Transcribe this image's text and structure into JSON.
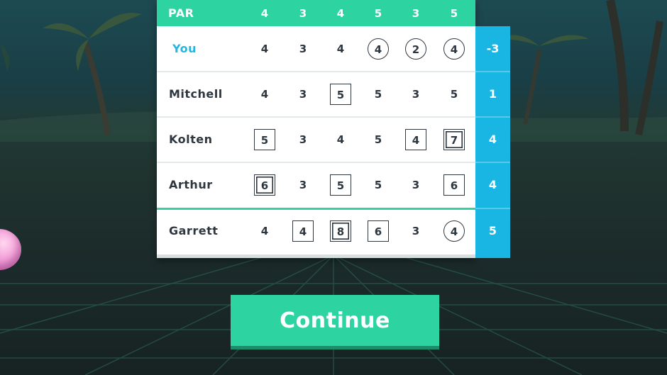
{
  "scorecard": {
    "par_label": "PAR",
    "par": [
      "4",
      "3",
      "4",
      "5",
      "3",
      "5"
    ],
    "players": [
      {
        "name": "You",
        "scores": [
          "4",
          "3",
          "4",
          "4",
          "2",
          "4"
        ],
        "marks": [
          "none",
          "none",
          "none",
          "circle",
          "circle",
          "circle"
        ],
        "total": "-3",
        "is_user": true
      },
      {
        "name": "Mitchell",
        "scores": [
          "4",
          "3",
          "5",
          "5",
          "3",
          "5"
        ],
        "marks": [
          "none",
          "none",
          "square",
          "none",
          "none",
          "none"
        ],
        "total": "1",
        "is_user": false
      },
      {
        "name": "Kolten",
        "scores": [
          "5",
          "3",
          "4",
          "5",
          "4",
          "7"
        ],
        "marks": [
          "square",
          "none",
          "none",
          "none",
          "square",
          "double"
        ],
        "total": "4",
        "is_user": false
      },
      {
        "name": "Arthur",
        "scores": [
          "6",
          "3",
          "5",
          "5",
          "3",
          "6"
        ],
        "marks": [
          "double",
          "none",
          "square",
          "none",
          "none",
          "square"
        ],
        "total": "4",
        "is_user": false
      },
      {
        "name": "Garrett",
        "scores": [
          "4",
          "4",
          "8",
          "6",
          "3",
          "4"
        ],
        "marks": [
          "none",
          "square",
          "double",
          "square",
          "none",
          "circle"
        ],
        "total": "5",
        "is_user": false
      }
    ]
  },
  "continue_button": {
    "label": "Continue"
  },
  "colors": {
    "accent_green": "#2dd3a1",
    "total_blue": "#19b6e3",
    "user_name": "#22b6e0",
    "text_dark": "#2e3740"
  }
}
